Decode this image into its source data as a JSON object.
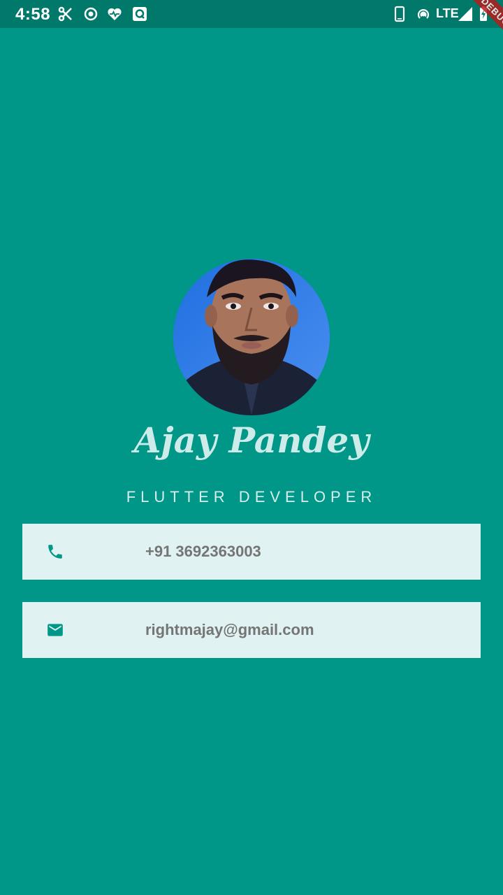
{
  "status_bar": {
    "time": "4:58",
    "network_label": "LTE",
    "icons": [
      "scissors-icon",
      "radio-icon",
      "heart-icon",
      "q-app-icon",
      "phone-outline-icon",
      "hotspot-icon",
      "signal-icon",
      "battery-charging-icon"
    ]
  },
  "debug_banner": "DEBUG",
  "profile": {
    "name": "Ajay Pandey",
    "title": "FLUTTER DEVELOPER",
    "avatar": "profile-photo"
  },
  "contacts": {
    "phone": {
      "icon": "phone-icon",
      "text": "+91 3692363003"
    },
    "email": {
      "icon": "mail-icon",
      "text": "rightmajay@gmail.com"
    }
  },
  "colors": {
    "background": "#009688",
    "status_bar": "#00796b",
    "card": "#e0f2f1",
    "accent_icon": "#009688",
    "card_text": "#757575"
  }
}
